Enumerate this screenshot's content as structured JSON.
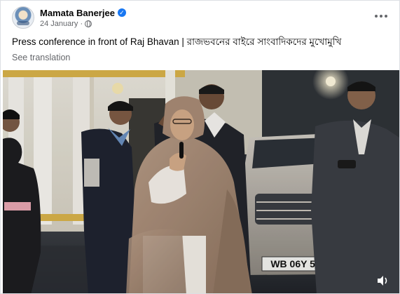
{
  "post": {
    "author": "Mamata Banerjee",
    "date": "24 January",
    "caption": "Press conference in front of Raj Bhavan | রাজভবনের বাইরে সাংবাদিকদের মুখোমুখি",
    "see_translation": "See translation",
    "plate_text": "WB 06Y 55"
  },
  "icons": {
    "verified": "verified-badge-icon",
    "audience": "globe-icon",
    "menu": "more-options-icon",
    "volume": "volume-icon"
  },
  "colors": {
    "text": "#050505",
    "secondary_text": "#65676b",
    "verified_blue": "#1877f2"
  }
}
